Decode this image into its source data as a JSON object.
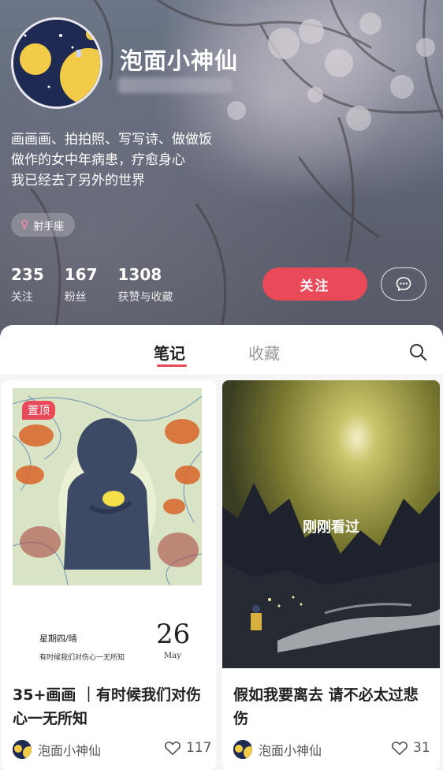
{
  "profile": {
    "username": "泡面小神仙",
    "bio": [
      "画画画、拍拍照、写写诗、做做饭",
      "做作的女中年病患，疗愈身心",
      "我已经去了另外的世界"
    ],
    "tag": "射手座",
    "stats": [
      {
        "num": "235",
        "label": "关注"
      },
      {
        "num": "167",
        "label": "粉丝"
      },
      {
        "num": "1308",
        "label": "获赞与收藏"
      }
    ],
    "follow_label": "关注"
  },
  "tabs": {
    "notes": "笔记",
    "collect": "收藏"
  },
  "notes": [
    {
      "badge": "置顶",
      "diary_week": "星期四/晴",
      "diary_line": "有时候我们对伤心一无所知",
      "diary_day": "26",
      "diary_month": "May",
      "title": "35+画画 ｜有时候我们对伤心一无所知",
      "author": "泡面小神仙",
      "likes": "117"
    },
    {
      "overlay": "刚刚看过",
      "title": "假如我要离去 请不必太过悲伤",
      "author": "泡面小神仙",
      "likes": "31"
    }
  ],
  "colors": {
    "accent": "#e84a5a"
  },
  "icons": [
    "female-icon",
    "message-icon",
    "search-icon",
    "heart-icon"
  ]
}
